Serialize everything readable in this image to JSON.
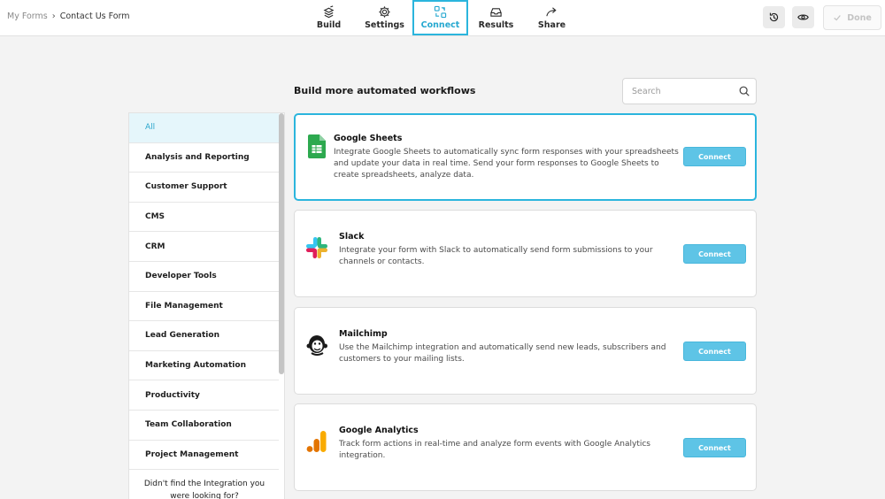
{
  "breadcrumb": {
    "parent": "My Forms",
    "separator": "›",
    "current": "Contact Us Form"
  },
  "nav": [
    {
      "label": "Build",
      "icon": "build-icon"
    },
    {
      "label": "Settings",
      "icon": "gear-icon"
    },
    {
      "label": "Connect",
      "icon": "connect-icon",
      "active": true
    },
    {
      "label": "Results",
      "icon": "inbox-icon"
    },
    {
      "label": "Share",
      "icon": "share-arrow-icon"
    }
  ],
  "toolbar": {
    "done_label": "Done"
  },
  "main": {
    "title": "Build more automated workflows",
    "search_placeholder": "Search"
  },
  "sidebar": {
    "categories": [
      "All",
      "Analysis and Reporting",
      "Customer Support",
      "CMS",
      "CRM",
      "Developer Tools",
      "File Management",
      "Lead Generation",
      "Marketing Automation",
      "Productivity",
      "Team Collaboration",
      "Project Management"
    ],
    "active_index": 0,
    "not_found_line1": "Didn't find the Integration you",
    "not_found_line2": "were looking for?"
  },
  "integrations": [
    {
      "name": "Google Sheets",
      "icon": "google-sheets-icon",
      "description": "Integrate Google Sheets to automatically sync form responses with your spreadsheets and update your data in real time. Send your form responses to Google Sheets to create spreadsheets, analyze data.",
      "button": "Connect"
    },
    {
      "name": "Slack",
      "icon": "slack-icon",
      "description": "Integrate your form with Slack to automatically send form submissions to your channels or contacts.",
      "button": "Connect"
    },
    {
      "name": "Mailchimp",
      "icon": "mailchimp-icon",
      "description": "Use the Mailchimp integration and automatically send new leads, subscribers and customers to your mailing lists.",
      "button": "Connect"
    },
    {
      "name": "Google Analytics",
      "icon": "google-analytics-icon",
      "description": "Track form actions in real-time and analyze form events with Google Analytics integration.",
      "button": "Connect"
    }
  ],
  "colors": {
    "accent": "#2bb5dd",
    "connect_button": "#5ec4e6",
    "active_category_bg": "#e5f6fb"
  }
}
